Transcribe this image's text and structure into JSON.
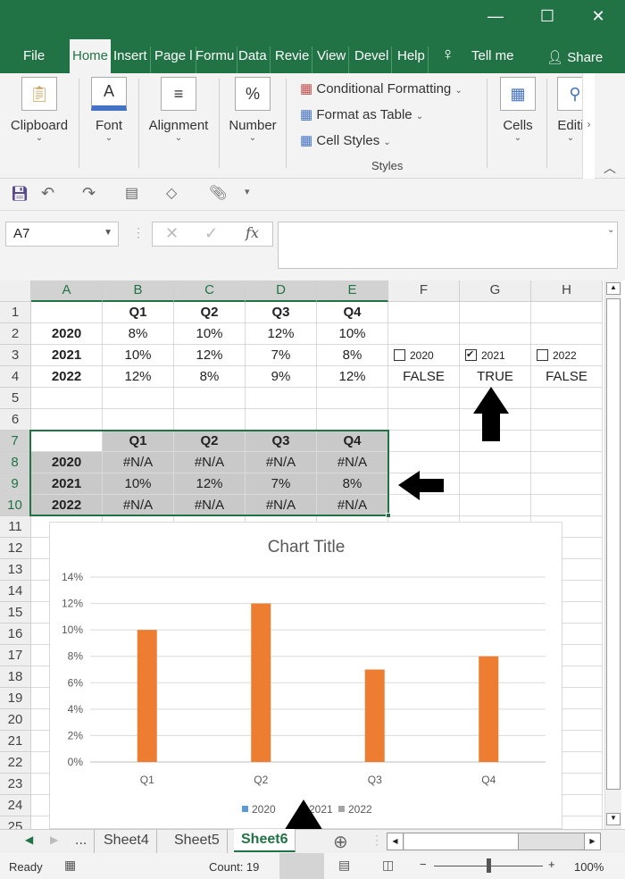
{
  "window": {
    "minimize": "—",
    "maximize": "☐",
    "close": "✕"
  },
  "ribbon_tabs": [
    "File",
    "Home",
    "Insert",
    "Page l",
    "Formu",
    "Data",
    "Revie",
    "View",
    "Devel",
    "Help"
  ],
  "tell_me": "Tell me",
  "share": "Share",
  "groups": {
    "clipboard": "Clipboard",
    "font": "Font",
    "alignment": "Alignment",
    "number": "Number",
    "cells": "Cells",
    "editing": "Editi",
    "styles": "Styles"
  },
  "styles_items": [
    "Conditional Formatting",
    "Format as Table",
    "Cell Styles"
  ],
  "name_box": "A7",
  "formula_bar": {
    "fx": "fx",
    "value": ""
  },
  "columns": [
    "A",
    "B",
    "C",
    "D",
    "E",
    "F",
    "G",
    "H"
  ],
  "rows": [
    [
      "",
      "Q1",
      "Q2",
      "Q3",
      "Q4",
      "",
      "",
      ""
    ],
    [
      "2020",
      "8%",
      "10%",
      "12%",
      "10%",
      "",
      "",
      ""
    ],
    [
      "2021",
      "10%",
      "12%",
      "7%",
      "8%",
      "",
      "",
      ""
    ],
    [
      "2022",
      "12%",
      "8%",
      "9%",
      "12%",
      "FALSE",
      "TRUE",
      "FALSE"
    ],
    [
      "",
      "",
      "",
      "",
      "",
      "",
      "",
      ""
    ],
    [
      "",
      "",
      "",
      "",
      "",
      "",
      "",
      ""
    ],
    [
      "",
      "Q1",
      "Q2",
      "Q3",
      "Q4",
      "",
      "",
      ""
    ],
    [
      "2020",
      "#N/A",
      "#N/A",
      "#N/A",
      "#N/A",
      "",
      "",
      ""
    ],
    [
      "2021",
      "10%",
      "12%",
      "7%",
      "8%",
      "",
      "",
      ""
    ],
    [
      "2022",
      "#N/A",
      "#N/A",
      "#N/A",
      "#N/A",
      "",
      "",
      ""
    ]
  ],
  "checkboxes": [
    {
      "label": "2020",
      "checked": false
    },
    {
      "label": "2021",
      "checked": true
    },
    {
      "label": "2022",
      "checked": false
    }
  ],
  "chart_data": {
    "type": "bar",
    "title": "Chart Title",
    "categories": [
      "Q1",
      "Q2",
      "Q3",
      "Q4"
    ],
    "ylim": [
      0,
      14
    ],
    "yticks": [
      "0%",
      "2%",
      "4%",
      "6%",
      "8%",
      "10%",
      "12%",
      "14%"
    ],
    "series": [
      {
        "name": "2020",
        "color": "#5b9bd5",
        "values": [
          null,
          null,
          null,
          null
        ]
      },
      {
        "name": "2021",
        "color": "#ed7d31",
        "values": [
          10,
          12,
          7,
          8
        ]
      },
      {
        "name": "2022",
        "color": "#a5a5a5",
        "values": [
          null,
          null,
          null,
          null
        ]
      }
    ],
    "grid": true,
    "legend": "bottom"
  },
  "sheet_tabs": [
    "...",
    "Sheet4",
    "Sheet5",
    "Sheet6"
  ],
  "status": {
    "ready": "Ready",
    "count": "Count: 19",
    "zoom": "100%"
  },
  "colors": {
    "accent": "#217346"
  }
}
